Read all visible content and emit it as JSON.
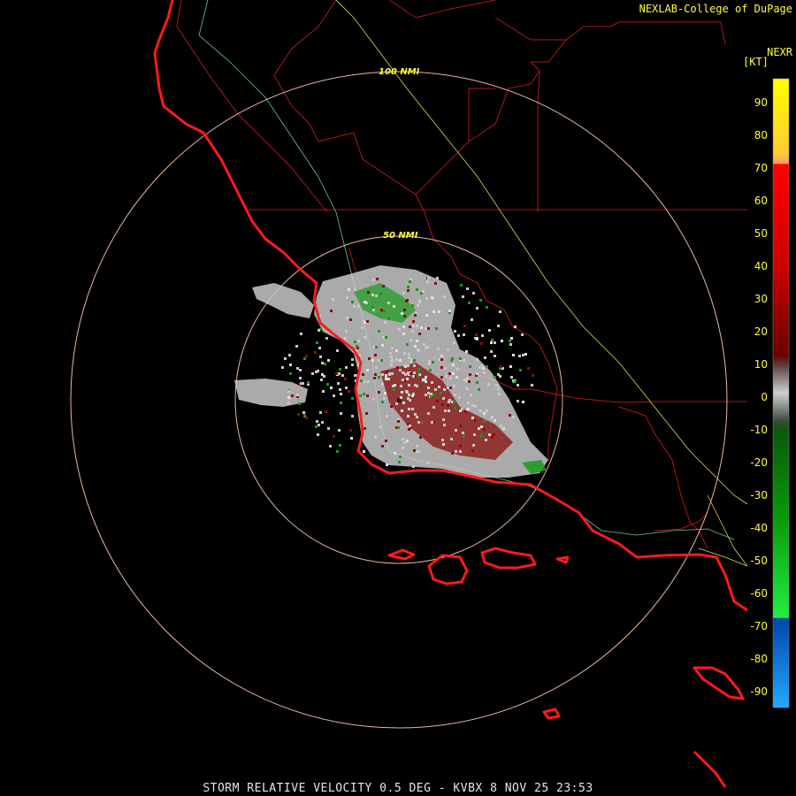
{
  "credit": "NEXLAB-College of DuPage",
  "product_code": "NEXR",
  "units": "[KT]",
  "caption": "STORM RELATIVE VELOCITY 0.5 DEG - KVBX 8 NOV 25 23:53",
  "range_rings": [
    "100 NMI",
    "50 NMI"
  ],
  "legend": {
    "ticks": [
      "90",
      "80",
      "70",
      "60",
      "50",
      "40",
      "30",
      "20",
      "10",
      "0",
      "-10",
      "-20",
      "-30",
      "-40",
      "-50",
      "-60",
      "-70",
      "-80",
      "-90"
    ]
  },
  "colors": {
    "coastline": "#ff1a1a",
    "state_border": "#b01818",
    "ring": "#e8b8a0",
    "highway_green": "#66cc88",
    "highway_yellow": "#dddd44",
    "text": "#ffff33",
    "return_gray": "#c8c8c8",
    "inbound_green": "#1a9a1a",
    "outbound_red": "#8a0d0d"
  }
}
